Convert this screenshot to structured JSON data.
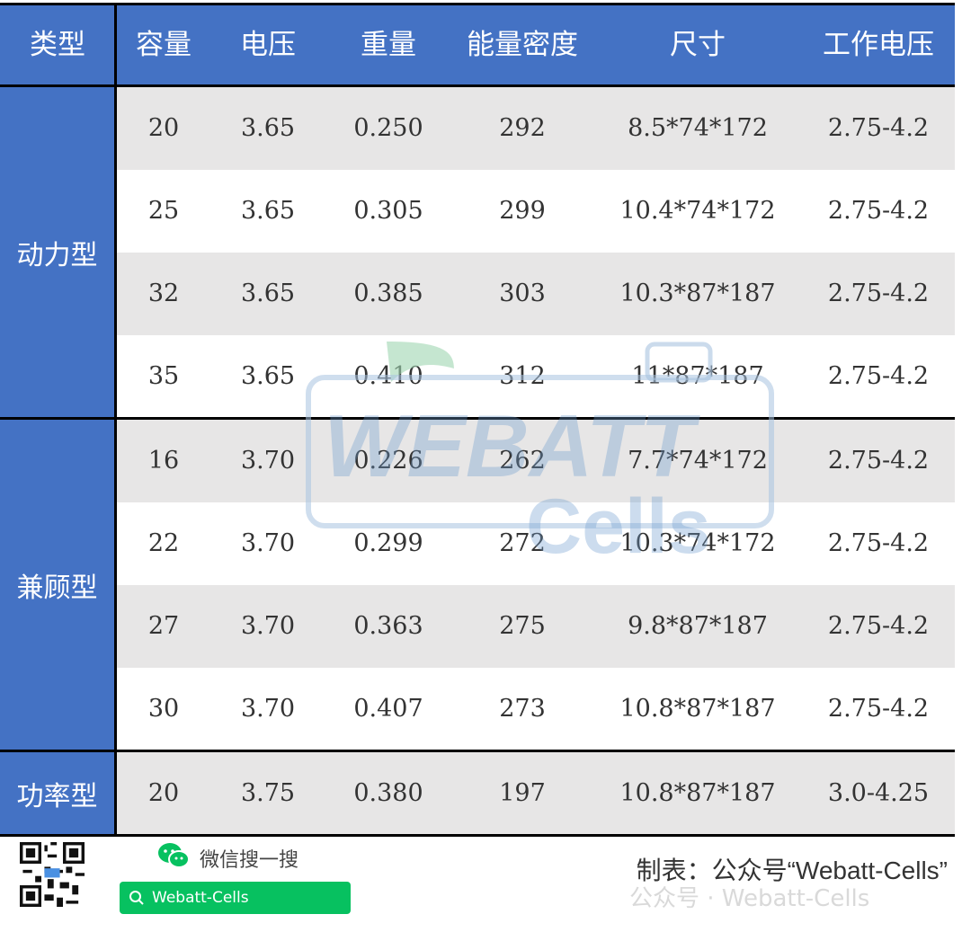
{
  "headers": [
    "类型",
    "容量",
    "电压",
    "重量",
    "能量密度",
    "尺寸",
    "工作电压"
  ],
  "groups": [
    {
      "type": "动力型",
      "rows": [
        [
          "20",
          "3.65",
          "0.250",
          "292",
          "8.5*74*172",
          "2.75-4.2"
        ],
        [
          "25",
          "3.65",
          "0.305",
          "299",
          "10.4*74*172",
          "2.75-4.2"
        ],
        [
          "32",
          "3.65",
          "0.385",
          "303",
          "10.3*87*187",
          "2.75-4.2"
        ],
        [
          "35",
          "3.65",
          "0.410",
          "312",
          "11*87*187",
          "2.75-4.2"
        ]
      ]
    },
    {
      "type": "兼顾型",
      "rows": [
        [
          "16",
          "3.70",
          "0.226",
          "262",
          "7.7*74*172",
          "2.75-4.2"
        ],
        [
          "22",
          "3.70",
          "0.299",
          "272",
          "10.3*74*172",
          "2.75-4.2"
        ],
        [
          "27",
          "3.70",
          "0.363",
          "275",
          "9.8*87*187",
          "2.75-4.2"
        ],
        [
          "30",
          "3.70",
          "0.407",
          "273",
          "10.8*87*187",
          "2.75-4.2"
        ]
      ]
    },
    {
      "type": "功率型",
      "rows": [
        [
          "20",
          "3.75",
          "0.380",
          "197",
          "10.8*87*187",
          "3.0-4.25"
        ]
      ]
    }
  ],
  "watermark": {
    "brand": "WEBATT",
    "sub": "Cells"
  },
  "footer": {
    "wechat_search_label": "微信搜一搜",
    "search_box_text": "Webatt-Cells",
    "credit": "制表：公众号“Webatt-Cells”",
    "ghost_text": "公众号 · Webatt-Cells"
  },
  "colors": {
    "header_bg": "#4472c4",
    "row_shade": "#e7e6e6",
    "wechat_green": "#07c160"
  }
}
